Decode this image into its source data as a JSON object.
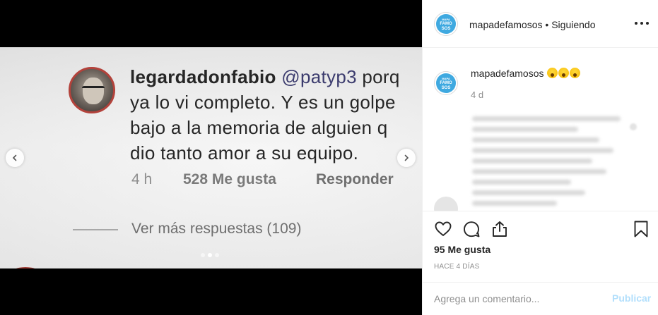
{
  "media": {
    "comment_username": "legardadonfabio",
    "comment_mention": "@patyp3",
    "comment_body": " porq ya lo vi completo. Y es un golpe bajo a la memoria de alguien q dio tanto amor a su equipo.",
    "comment_time": "4 h",
    "comment_likes": "528 Me gusta",
    "comment_reply": "Responder",
    "view_more_replies": "Ver más respuestas (109)",
    "carousel_dots": 3,
    "carousel_active_index": 1
  },
  "header": {
    "logo_text_top": "MAPA",
    "logo_text_main": "FAMO",
    "logo_text_bottom": "SOS",
    "username": "mapadefamosos",
    "separator": " • ",
    "follow_status": "Siguiendo"
  },
  "caption": {
    "username": "mapadefamosos",
    "emojis": [
      "face-screaming-in-fear",
      "face-screaming-in-fear",
      "face-screaming-in-fear"
    ],
    "time": "4 d"
  },
  "actions": {
    "likes": "95 Me gusta",
    "date": "HACE 4 DÍAS",
    "comment_placeholder": "Agrega un comentario...",
    "publish_label": "Publicar"
  },
  "colors": {
    "brand_blue": "#3fa9e0",
    "publish_disabled": "#b2dffc",
    "avatar_ring": "#b3423b"
  }
}
